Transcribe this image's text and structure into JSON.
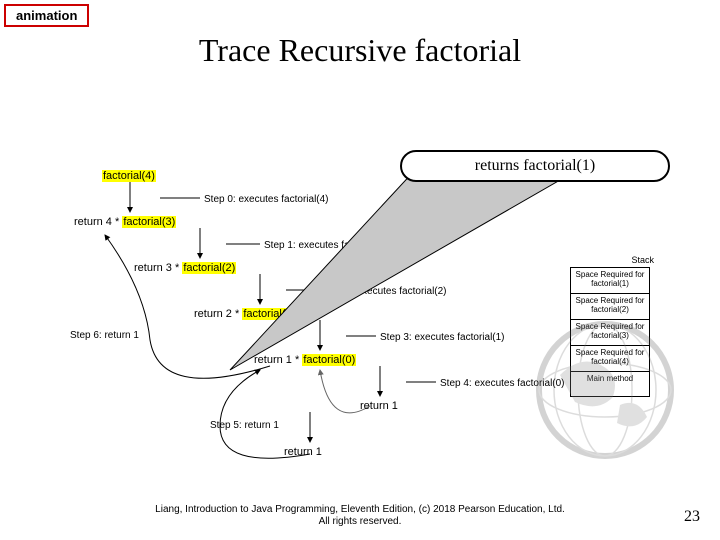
{
  "tag": "animation",
  "title": "Trace Recursive factorial",
  "callout": "returns factorial(1)",
  "nodes": {
    "f4": "factorial(4)",
    "r4": "return 4 *",
    "f3": "factorial(3)",
    "r3": "return 3 *",
    "f2": "factorial(2)",
    "r2": "return 2 *",
    "f1": "factorial(1)",
    "r1": "return 1 *",
    "f0": "factorial(0)",
    "ret1": "return 1"
  },
  "steps": {
    "s0": "Step 0: executes factorial(4)",
    "s1": "Step 1: executes factorial(3)",
    "s2": "Step 2: executes factorial(2)",
    "s3": "Step 3: executes factorial(1)",
    "s4": "Step 4: executes factorial(0)",
    "s5": "Step 5: return 1",
    "s6": "Step 6: return 1"
  },
  "stack": {
    "label": "Stack",
    "frames": [
      "Space Required for factorial(1)",
      "Space Required for factorial(2)",
      "Space Required for factorial(3)",
      "Space Required for factorial(4)",
      "Main method"
    ]
  },
  "footer": {
    "line1": "Liang, Introduction to Java Programming, Eleventh Edition, (c) 2018 Pearson Education, Ltd.",
    "line2": "All rights reserved."
  },
  "page": "23"
}
